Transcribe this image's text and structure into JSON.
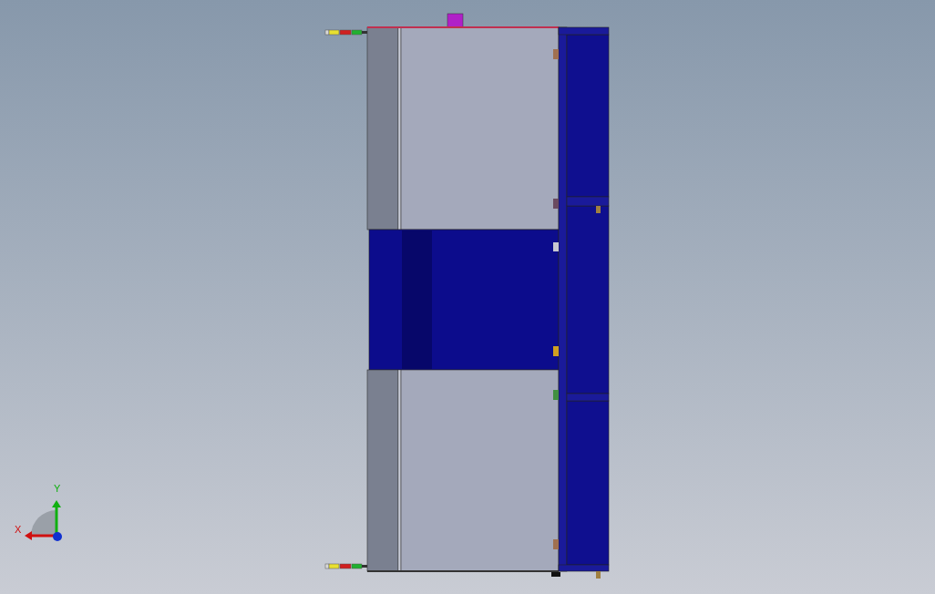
{
  "viewport": {
    "axis_triad": {
      "x_label": "X",
      "y_label": "Y"
    }
  }
}
